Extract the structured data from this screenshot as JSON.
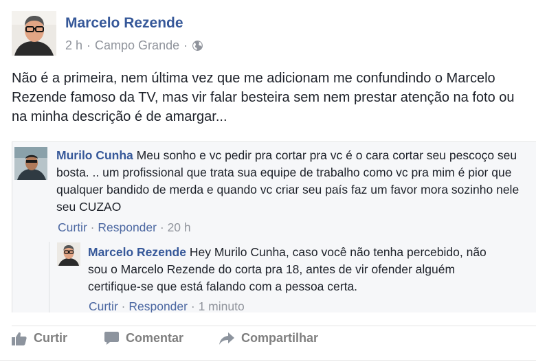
{
  "post": {
    "author": "Marcelo Rezende",
    "time": "2 h",
    "location": "Campo Grande",
    "separator": "·",
    "privacy_icon": "globe-icon",
    "text": "Não é a primeira, nem última vez que me adicionam me confundindo o Marcelo Rezende famoso da TV, mas vir falar besteira sem nem prestar atenção na foto ou na minha descrição é de amargar..."
  },
  "comments": [
    {
      "name": "Murilo Cunha",
      "text": "Meu sonho e vc pedir pra cortar pra vc é o cara cortar seu pescoço seu bosta. .. um profissional que trata sua equipe de trabalho como vc pra mim é pior que qualquer bandido de merda e quando vc criar seu país faz um favor mora sozinho nele seu CUZAO",
      "like_label": "Curtir",
      "reply_label": "Responder",
      "time": "20 h"
    },
    {
      "name": "Marcelo Rezende",
      "text": "Hey Murilo Cunha, caso você não tenha percebido, não sou o Marcelo Rezende do corta pra 18, antes de vir ofender alguém certifique-se que está falando com a pessoa certa.",
      "like_label": "Curtir",
      "reply_label": "Responder",
      "time": "1 minuto"
    }
  ],
  "actions": {
    "like": "Curtir",
    "comment": "Comentar",
    "share": "Compartilhar"
  },
  "colors": {
    "name_blue": "#365899",
    "meta_gray": "#90949c",
    "action_gray": "#7f7f7f"
  }
}
